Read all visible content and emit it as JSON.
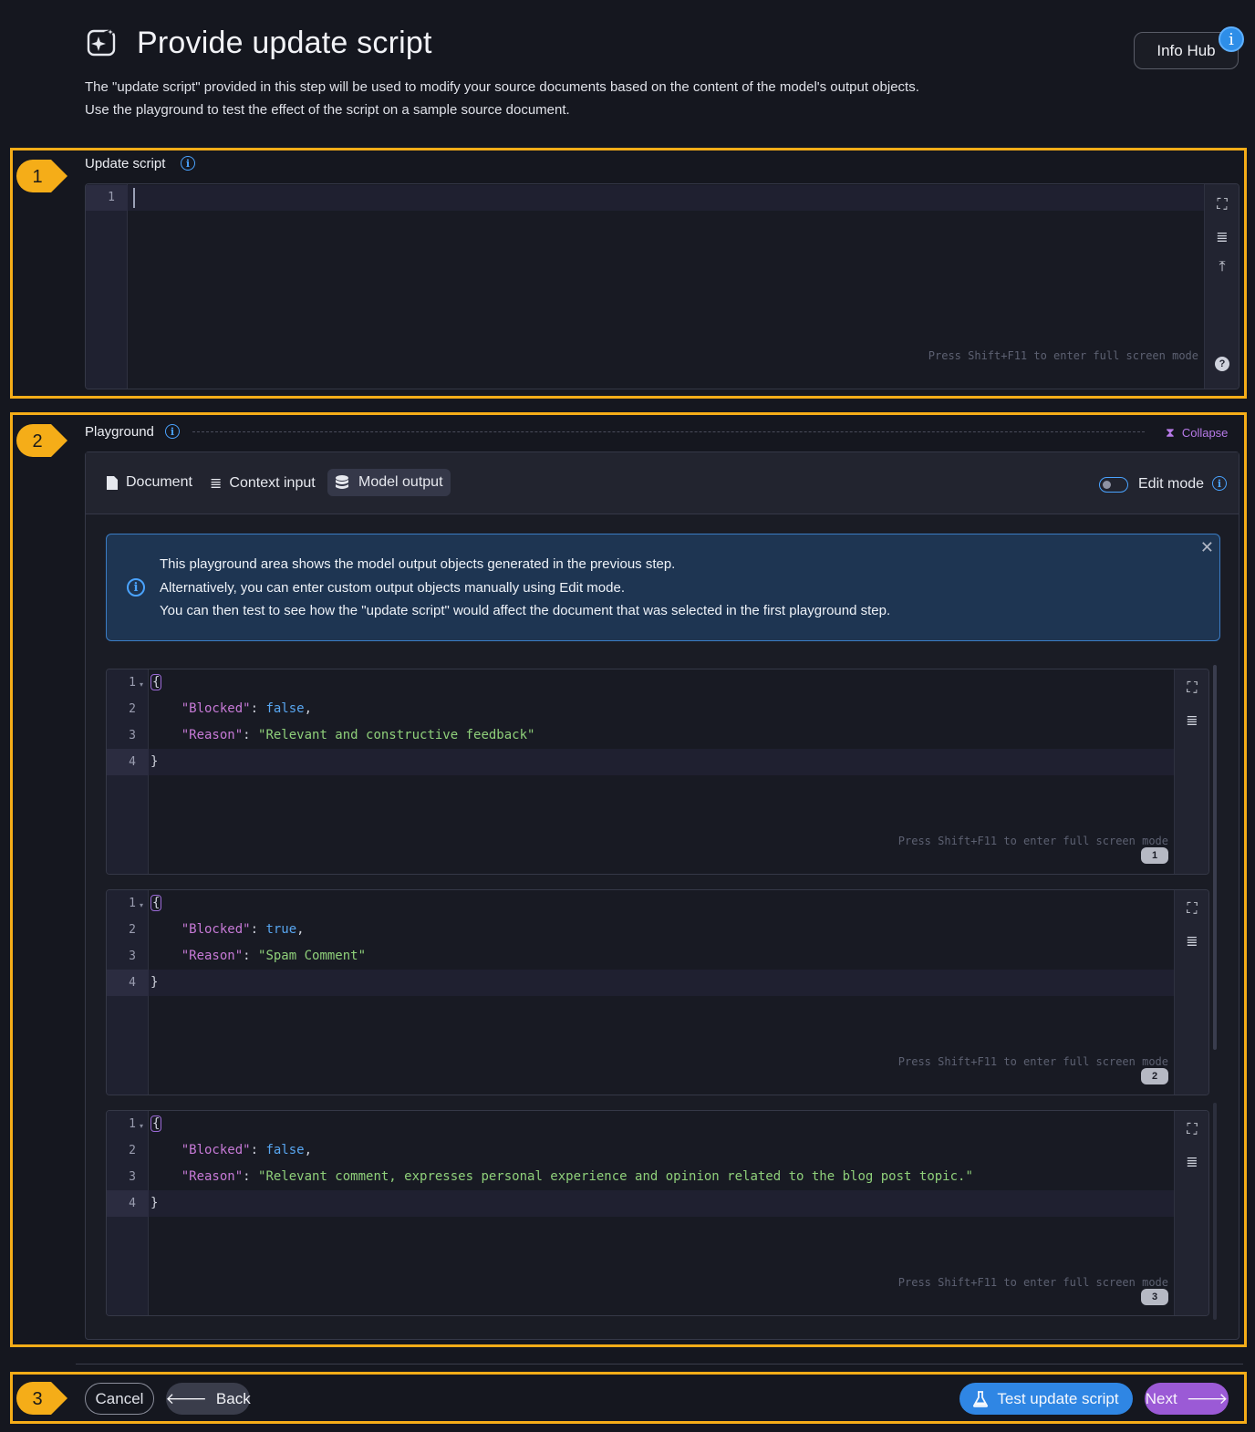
{
  "header": {
    "title": "Provide update script",
    "description_line1": "The \"update script\" provided in this step will be used to modify your source documents based on the content of the model's output objects.",
    "description_line2": "Use the playground to test the effect of the script on a sample source document.",
    "info_hub_label": "Info Hub",
    "info_hub_badge": "i"
  },
  "callouts": [
    "1",
    "2",
    "3"
  ],
  "update_script": {
    "label": "Update script",
    "line_numbers": [
      "1"
    ],
    "fullscreen_hint": "Press Shift+F11 to enter full screen mode"
  },
  "playground": {
    "label": "Playground",
    "collapse_label": "Collapse",
    "tabs": [
      {
        "label": "Document",
        "icon": "document-icon"
      },
      {
        "label": "Context input",
        "icon": "list-icon"
      },
      {
        "label": "Model output",
        "icon": "database-icon",
        "active": true
      }
    ],
    "edit_mode_label": "Edit mode",
    "alert": {
      "line1": "This playground area shows the model output objects generated in the previous step.",
      "line2": "Alternatively, you can enter custom output objects manually using Edit mode.",
      "line3": "You can then test to see how the \"update script\" would affect the document that was selected in the first playground step."
    },
    "outputs": [
      {
        "badge": "1",
        "line_numbers": [
          "1",
          "2",
          "3",
          "4"
        ],
        "blocked_key": "\"Blocked\"",
        "blocked_value": "false",
        "reason_key": "\"Reason\"",
        "reason_value": "\"Relevant and constructive feedback\"",
        "fullscreen_hint": "Press Shift+F11 to enter full screen mode"
      },
      {
        "badge": "2",
        "line_numbers": [
          "1",
          "2",
          "3",
          "4"
        ],
        "blocked_key": "\"Blocked\"",
        "blocked_value": "true",
        "reason_key": "\"Reason\"",
        "reason_value": "\"Spam Comment\"",
        "fullscreen_hint": "Press Shift+F11 to enter full screen mode"
      },
      {
        "badge": "3",
        "line_numbers": [
          "1",
          "2",
          "3",
          "4"
        ],
        "blocked_key": "\"Blocked\"",
        "blocked_value": "false",
        "reason_key": "\"Reason\"",
        "reason_value": "\"Relevant comment, expresses personal experience and opinion related to the blog post topic.\"",
        "fullscreen_hint": "Press Shift+F11 to enter full screen mode"
      }
    ]
  },
  "footer": {
    "cancel_label": "Cancel",
    "back_label": "Back",
    "test_label": "Test update script",
    "next_label": "Next"
  },
  "colors": {
    "callout": "#f5ad18",
    "primary": "#2f86e4",
    "next": "#9b5ad6",
    "background": "#15171f"
  }
}
